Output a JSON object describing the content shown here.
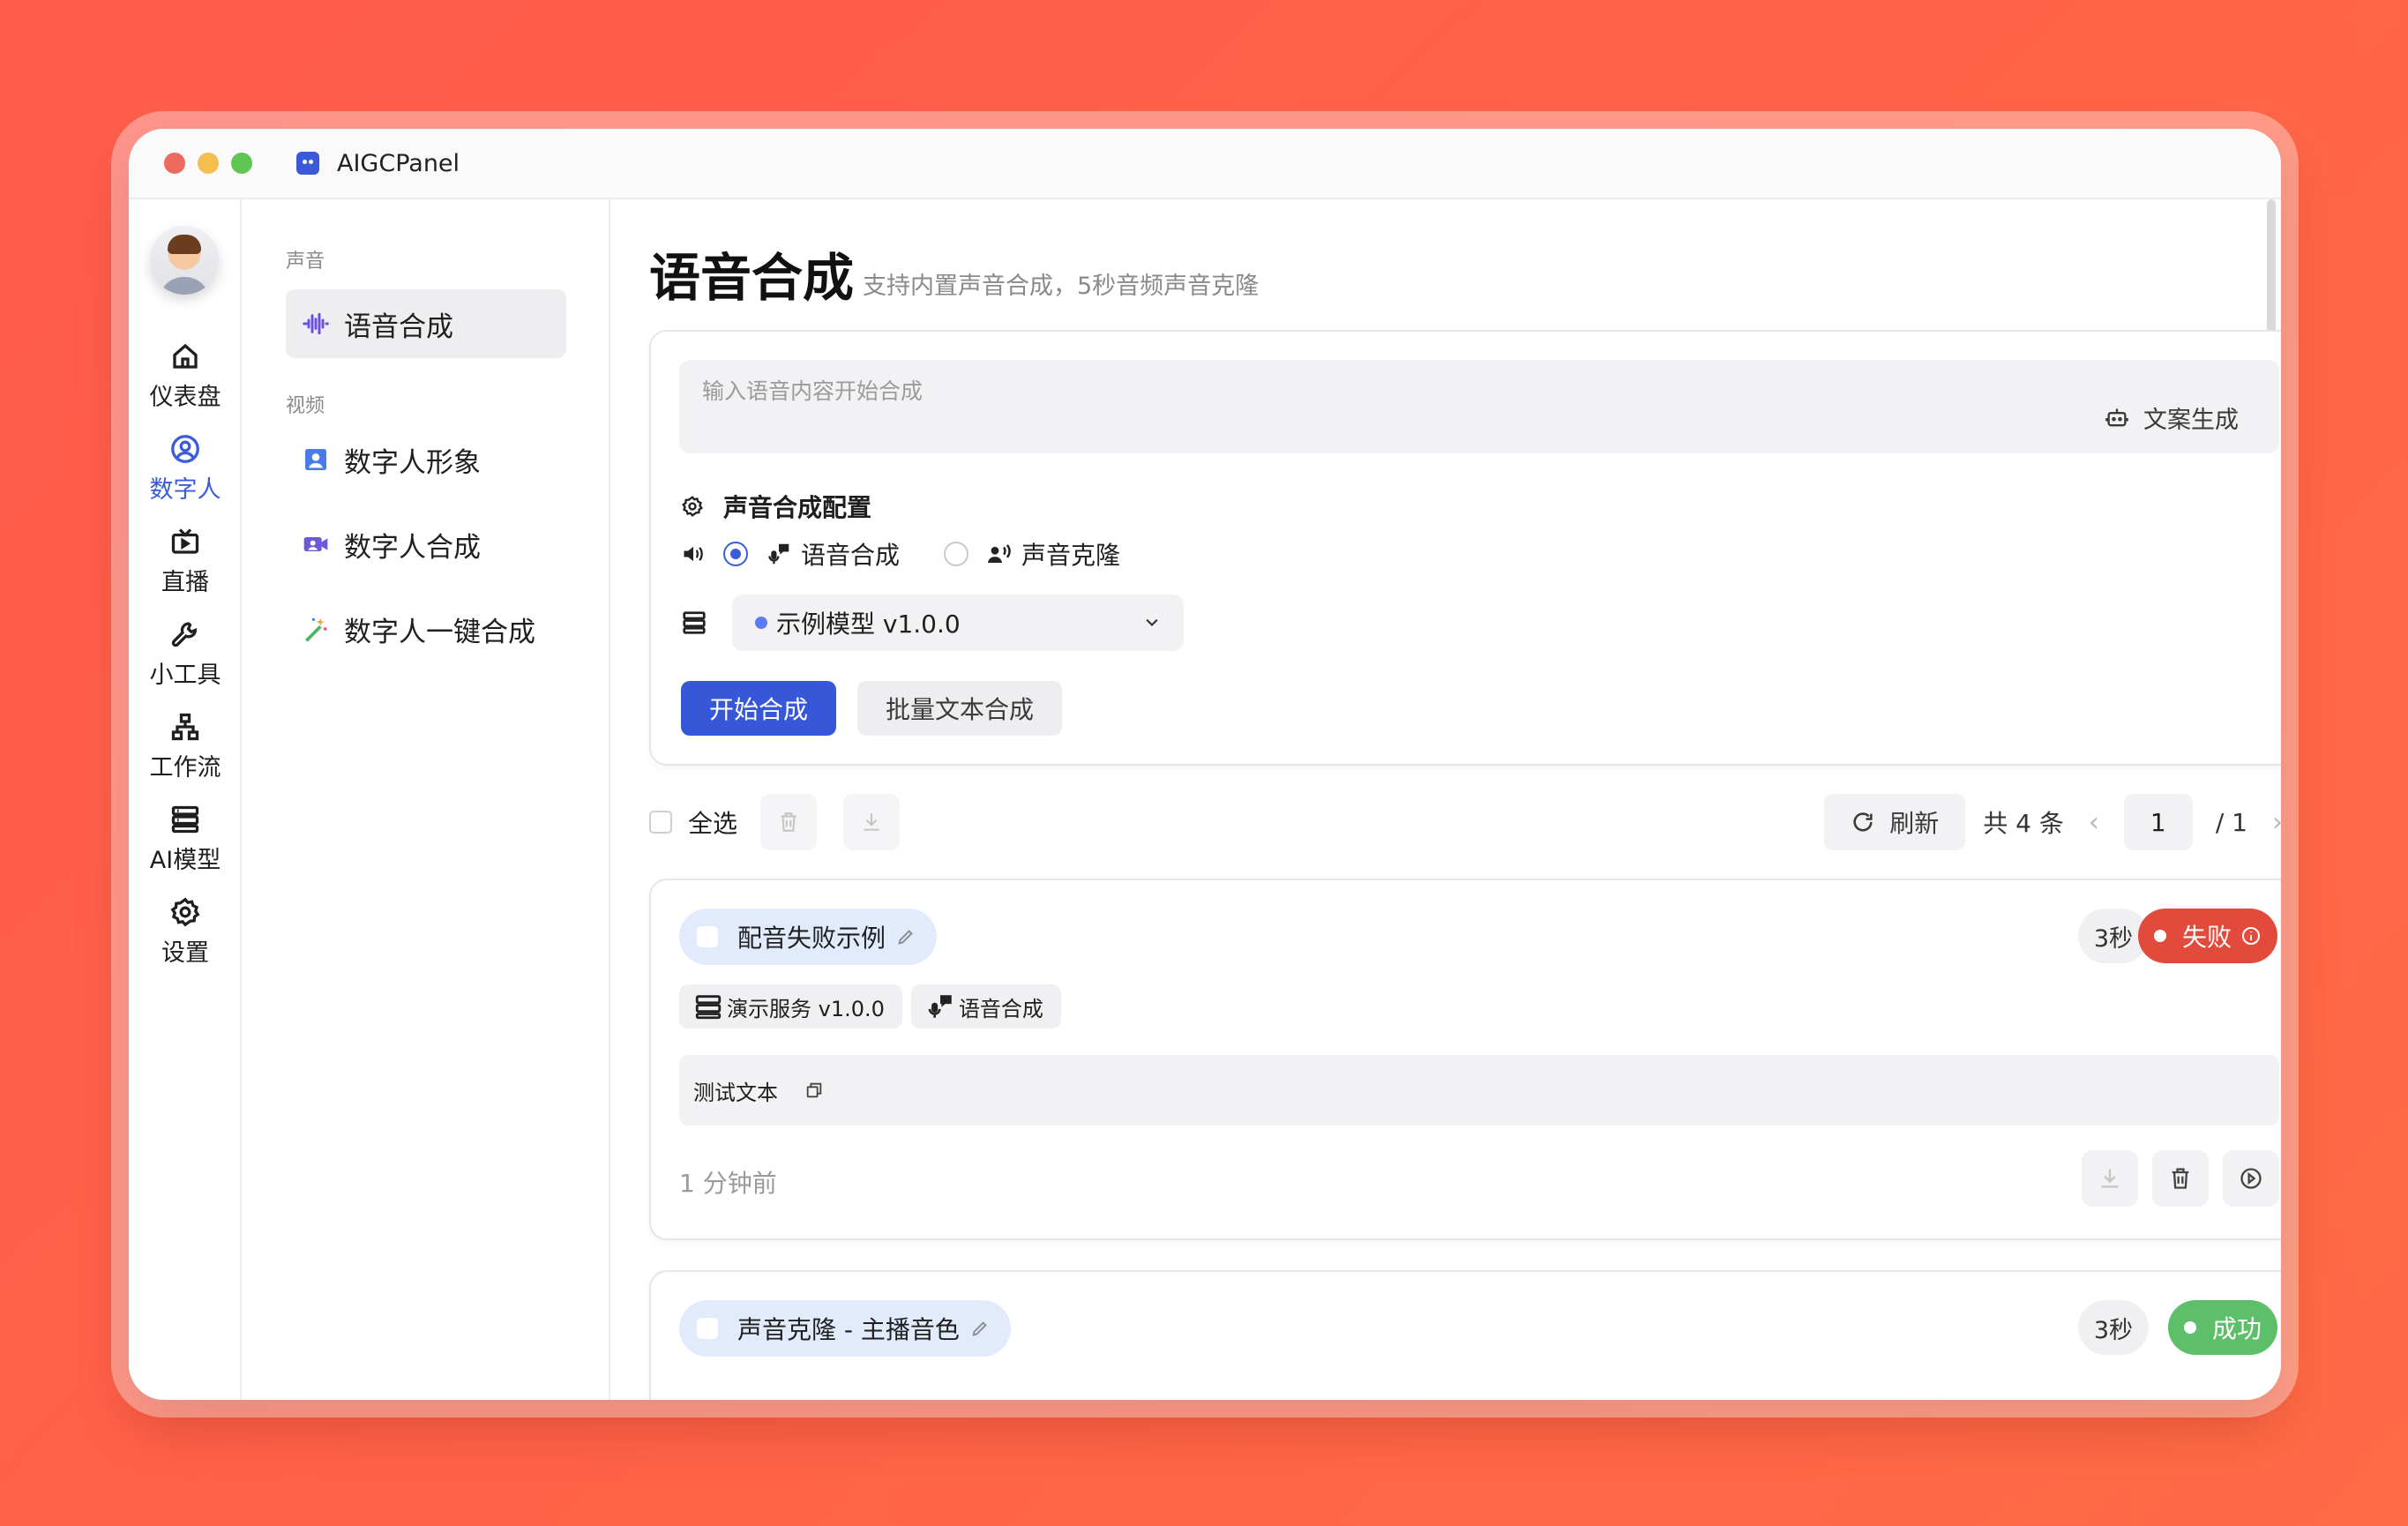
{
  "window": {
    "title": "AIGCPanel"
  },
  "rail": {
    "items": [
      {
        "label": "仪表盘",
        "icon": "home-icon",
        "active": false
      },
      {
        "label": "数字人",
        "icon": "user-circle-icon",
        "active": true
      },
      {
        "label": "直播",
        "icon": "tv-icon",
        "active": false
      },
      {
        "label": "小工具",
        "icon": "wrench-icon",
        "active": false
      },
      {
        "label": "工作流",
        "icon": "workflow-icon",
        "active": false
      },
      {
        "label": "AI模型",
        "icon": "server-icon",
        "active": false
      },
      {
        "label": "设置",
        "icon": "gear-icon",
        "active": false
      }
    ]
  },
  "subnav": {
    "group_sound": "声音",
    "group_video": "视频",
    "items": [
      {
        "label": "语音合成",
        "icon": "waveform-icon",
        "active": true
      },
      {
        "label": "数字人形象",
        "icon": "portrait-icon",
        "active": false
      },
      {
        "label": "数字人合成",
        "icon": "video-user-icon",
        "active": false
      },
      {
        "label": "数字人一键合成",
        "icon": "magic-wand-icon",
        "active": false
      }
    ]
  },
  "main": {
    "title": "语音合成",
    "subtitle": "支持内置声音合成，5秒音频声音克隆",
    "input_placeholder": "输入语音内容开始合成",
    "gen_copy_label": "文案生成",
    "config_title": "声音合成配置",
    "modes": [
      {
        "label": "语音合成",
        "selected": true
      },
      {
        "label": "声音克隆",
        "selected": false
      }
    ],
    "model_value": "示例模型 v1.0.0",
    "start_label": "开始合成",
    "batch_label": "批量文本合成"
  },
  "toolbar": {
    "select_all": "全选",
    "refresh": "刷新",
    "total": "共 4 条",
    "page": "1",
    "pages": "/  1"
  },
  "tasks": [
    {
      "name": "配音失败示例",
      "duration": "3秒",
      "status": "失败",
      "status_color": "#e24a3b",
      "tag_service": "演示服务 v1.0.0",
      "tag_mode": "语音合成",
      "text": "测试文本",
      "time": "1 分钟前"
    },
    {
      "name": "声音克隆 - 主播音色",
      "duration": "3秒",
      "status": "成功",
      "status_color": "#5dbf6a"
    }
  ],
  "colors": {
    "accent": "#3757d9",
    "background": "#ff5c4d"
  }
}
